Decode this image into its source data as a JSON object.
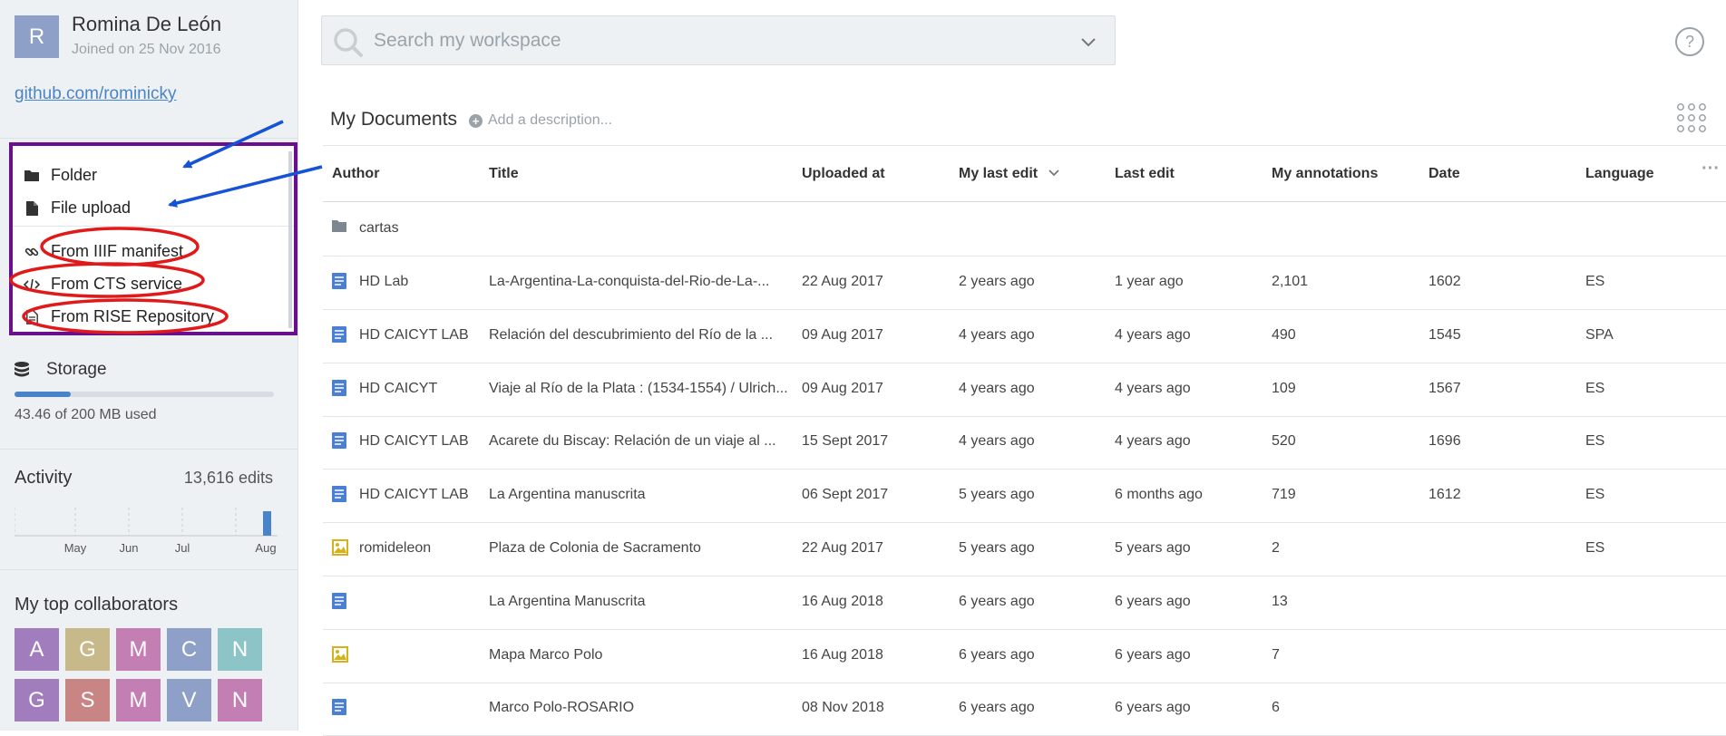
{
  "user": {
    "initial": "R",
    "name": "Romina De León",
    "joined": "Joined on 25 Nov 2016",
    "profile_link": "github.com/rominicky"
  },
  "new_menu": {
    "folder": "Folder",
    "file_upload": "File upload",
    "from_iiif": "From IIIF manifest",
    "from_cts": "From CTS service",
    "from_rise": "From RISE Repository"
  },
  "storage": {
    "label": "Storage",
    "used": "43.46 of 200 MB used",
    "fraction": 0.2173
  },
  "activity": {
    "title": "Activity",
    "count": "13,616 edits",
    "months": [
      "May",
      "Jun",
      "Jul",
      "Aug"
    ],
    "bar_level": 1
  },
  "collaborators": {
    "title": "My top collaborators",
    "tiles": [
      {
        "letter": "A",
        "color": "#a27dbd"
      },
      {
        "letter": "G",
        "color": "#c8b98a"
      },
      {
        "letter": "M",
        "color": "#c37fb4"
      },
      {
        "letter": "C",
        "color": "#8ea0c8"
      },
      {
        "letter": "N",
        "color": "#8cc4c8"
      },
      {
        "letter": "G",
        "color": "#a27dbd"
      },
      {
        "letter": "S",
        "color": "#c98484"
      },
      {
        "letter": "M",
        "color": "#c37fb4"
      },
      {
        "letter": "V",
        "color": "#8ea0c8"
      },
      {
        "letter": "N",
        "color": "#c37fb4"
      }
    ]
  },
  "search": {
    "placeholder": "Search my workspace"
  },
  "documents": {
    "title": "My Documents",
    "add_description": "Add a description...",
    "columns": [
      "Author",
      "Title",
      "Uploaded at",
      "My last edit",
      "Last edit",
      "My annotations",
      "Date",
      "Language"
    ],
    "folder_name": "cartas",
    "rows": [
      {
        "type": "text",
        "author": "HD Lab",
        "title": "La-Argentina-La-conquista-del-Rio-de-La-...",
        "uploaded": "22 Aug 2017",
        "my_last_edit": "2 years ago",
        "last_edit": "1 year ago",
        "annotations": "2,101",
        "date": "1602",
        "language": "ES"
      },
      {
        "type": "text",
        "author": "HD CAICYT LAB",
        "title": "Relación del descubrimiento del Río de la ...",
        "uploaded": "09 Aug 2017",
        "my_last_edit": "4 years ago",
        "last_edit": "4 years ago",
        "annotations": "490",
        "date": "1545",
        "language": "SPA"
      },
      {
        "type": "text",
        "author": "HD CAICYT",
        "title": "Viaje al Río de la Plata : (1534-1554) / Ulrich...",
        "uploaded": "09 Aug 2017",
        "my_last_edit": "4 years ago",
        "last_edit": "4 years ago",
        "annotations": "109",
        "date": "1567",
        "language": "ES"
      },
      {
        "type": "text",
        "author": "HD CAICYT LAB",
        "title": "Acarete du Biscay: Relación de un viaje al ...",
        "uploaded": "15 Sept 2017",
        "my_last_edit": "4 years ago",
        "last_edit": "4 years ago",
        "annotations": "520",
        "date": "1696",
        "language": "ES"
      },
      {
        "type": "text",
        "author": "HD CAICYT LAB",
        "title": "La Argentina manuscrita",
        "uploaded": "06 Sept 2017",
        "my_last_edit": "5 years ago",
        "last_edit": "6 months ago",
        "annotations": "719",
        "date": "1612",
        "language": "ES"
      },
      {
        "type": "image",
        "author": "romideleon",
        "title": "Plaza de Colonia de Sacramento",
        "uploaded": "22 Aug 2017",
        "my_last_edit": "5 years ago",
        "last_edit": "5 years ago",
        "annotations": "2",
        "date": "",
        "language": "ES"
      },
      {
        "type": "text",
        "author": "",
        "title": "La Argentina Manuscrita",
        "uploaded": "16 Aug 2018",
        "my_last_edit": "6 years ago",
        "last_edit": "6 years ago",
        "annotations": "13",
        "date": "",
        "language": ""
      },
      {
        "type": "image",
        "author": "",
        "title": "Mapa Marco Polo",
        "uploaded": "16 Aug 2018",
        "my_last_edit": "6 years ago",
        "last_edit": "6 years ago",
        "annotations": "7",
        "date": "",
        "language": ""
      },
      {
        "type": "text",
        "author": "",
        "title": "Marco Polo-ROSARIO",
        "uploaded": "08 Nov 2018",
        "my_last_edit": "6 years ago",
        "last_edit": "6 years ago",
        "annotations": "6",
        "date": "",
        "language": ""
      }
    ]
  },
  "colors": {
    "accent": "#4a84c8",
    "menu_highlight": "#6a0f8e",
    "annotation_circle": "#e01a1a",
    "annotation_arrow": "#1552d6"
  }
}
